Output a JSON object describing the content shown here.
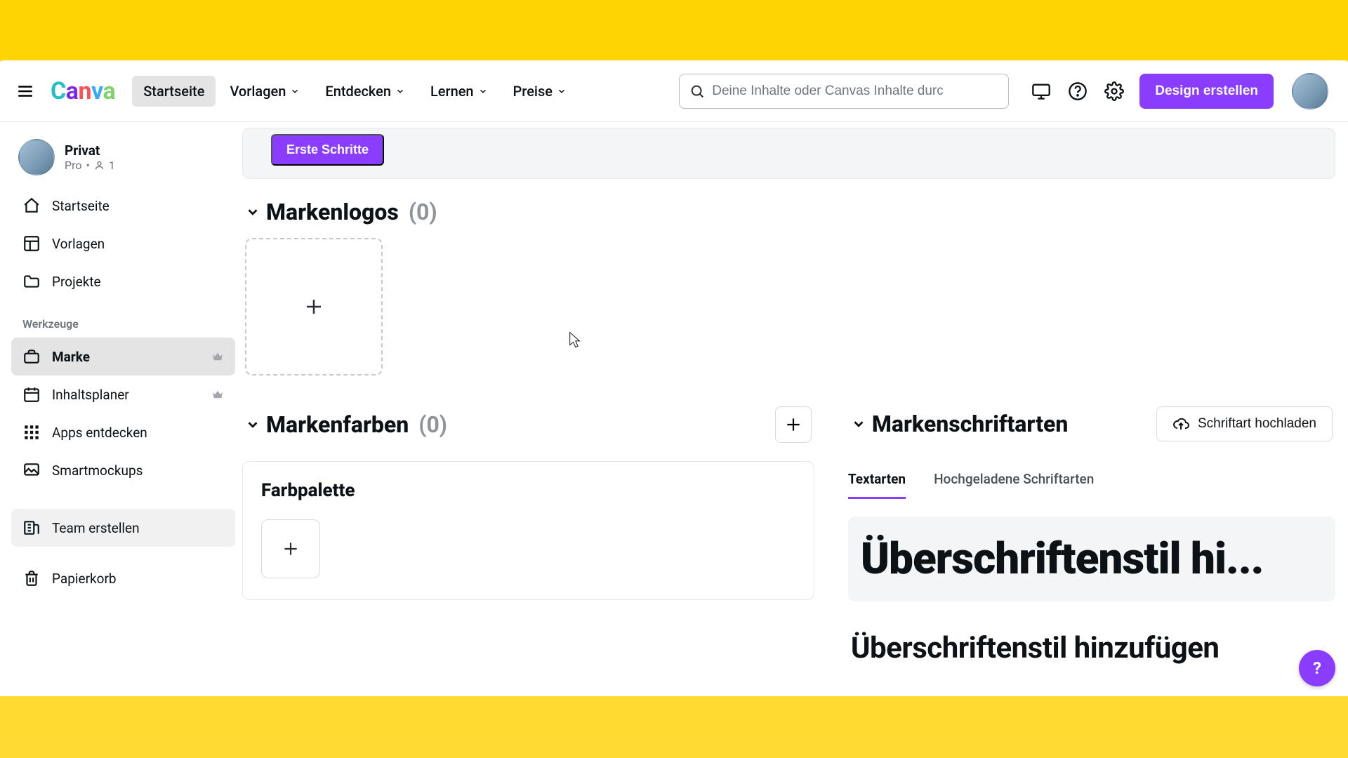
{
  "topnav": {
    "items": [
      {
        "label": "Startseite"
      },
      {
        "label": "Vorlagen"
      },
      {
        "label": "Entdecken"
      },
      {
        "label": "Lernen"
      },
      {
        "label": "Preise"
      }
    ],
    "active_index": 0
  },
  "search": {
    "placeholder": "Deine Inhalte oder Canvas Inhalte durc"
  },
  "cta": {
    "label": "Design erstellen"
  },
  "user": {
    "name": "Privat",
    "plan": "Pro",
    "members": "1"
  },
  "sidebar": {
    "main": [
      {
        "label": "Startseite"
      },
      {
        "label": "Vorlagen"
      },
      {
        "label": "Projekte"
      }
    ],
    "tools_header": "Werkzeuge",
    "tools": [
      {
        "label": "Marke",
        "crown": true
      },
      {
        "label": "Inhaltsplaner",
        "crown": true
      },
      {
        "label": "Apps entdecken"
      },
      {
        "label": "Smartmockups"
      }
    ],
    "active_tool_index": 0,
    "team_button": "Team erstellen",
    "trash": "Papierkorb"
  },
  "banner": {
    "first_steps": "Erste Schritte"
  },
  "logos_section": {
    "title": "Markenlogos",
    "count": "(0)"
  },
  "colors_section": {
    "title": "Markenfarben",
    "count": "(0)",
    "palette_card_title": "Farbpalette"
  },
  "fonts_section": {
    "title": "Markenschriftarten",
    "upload_button": "Schriftart hochladen",
    "tabs": [
      {
        "label": "Textarten"
      },
      {
        "label": "Hochgeladene Schriftarten"
      }
    ],
    "active_tab_index": 0,
    "style_big": "Überschriftenstil hi...",
    "style_med": "Überschriftenstil hinzufügen"
  },
  "help_fab": "?"
}
